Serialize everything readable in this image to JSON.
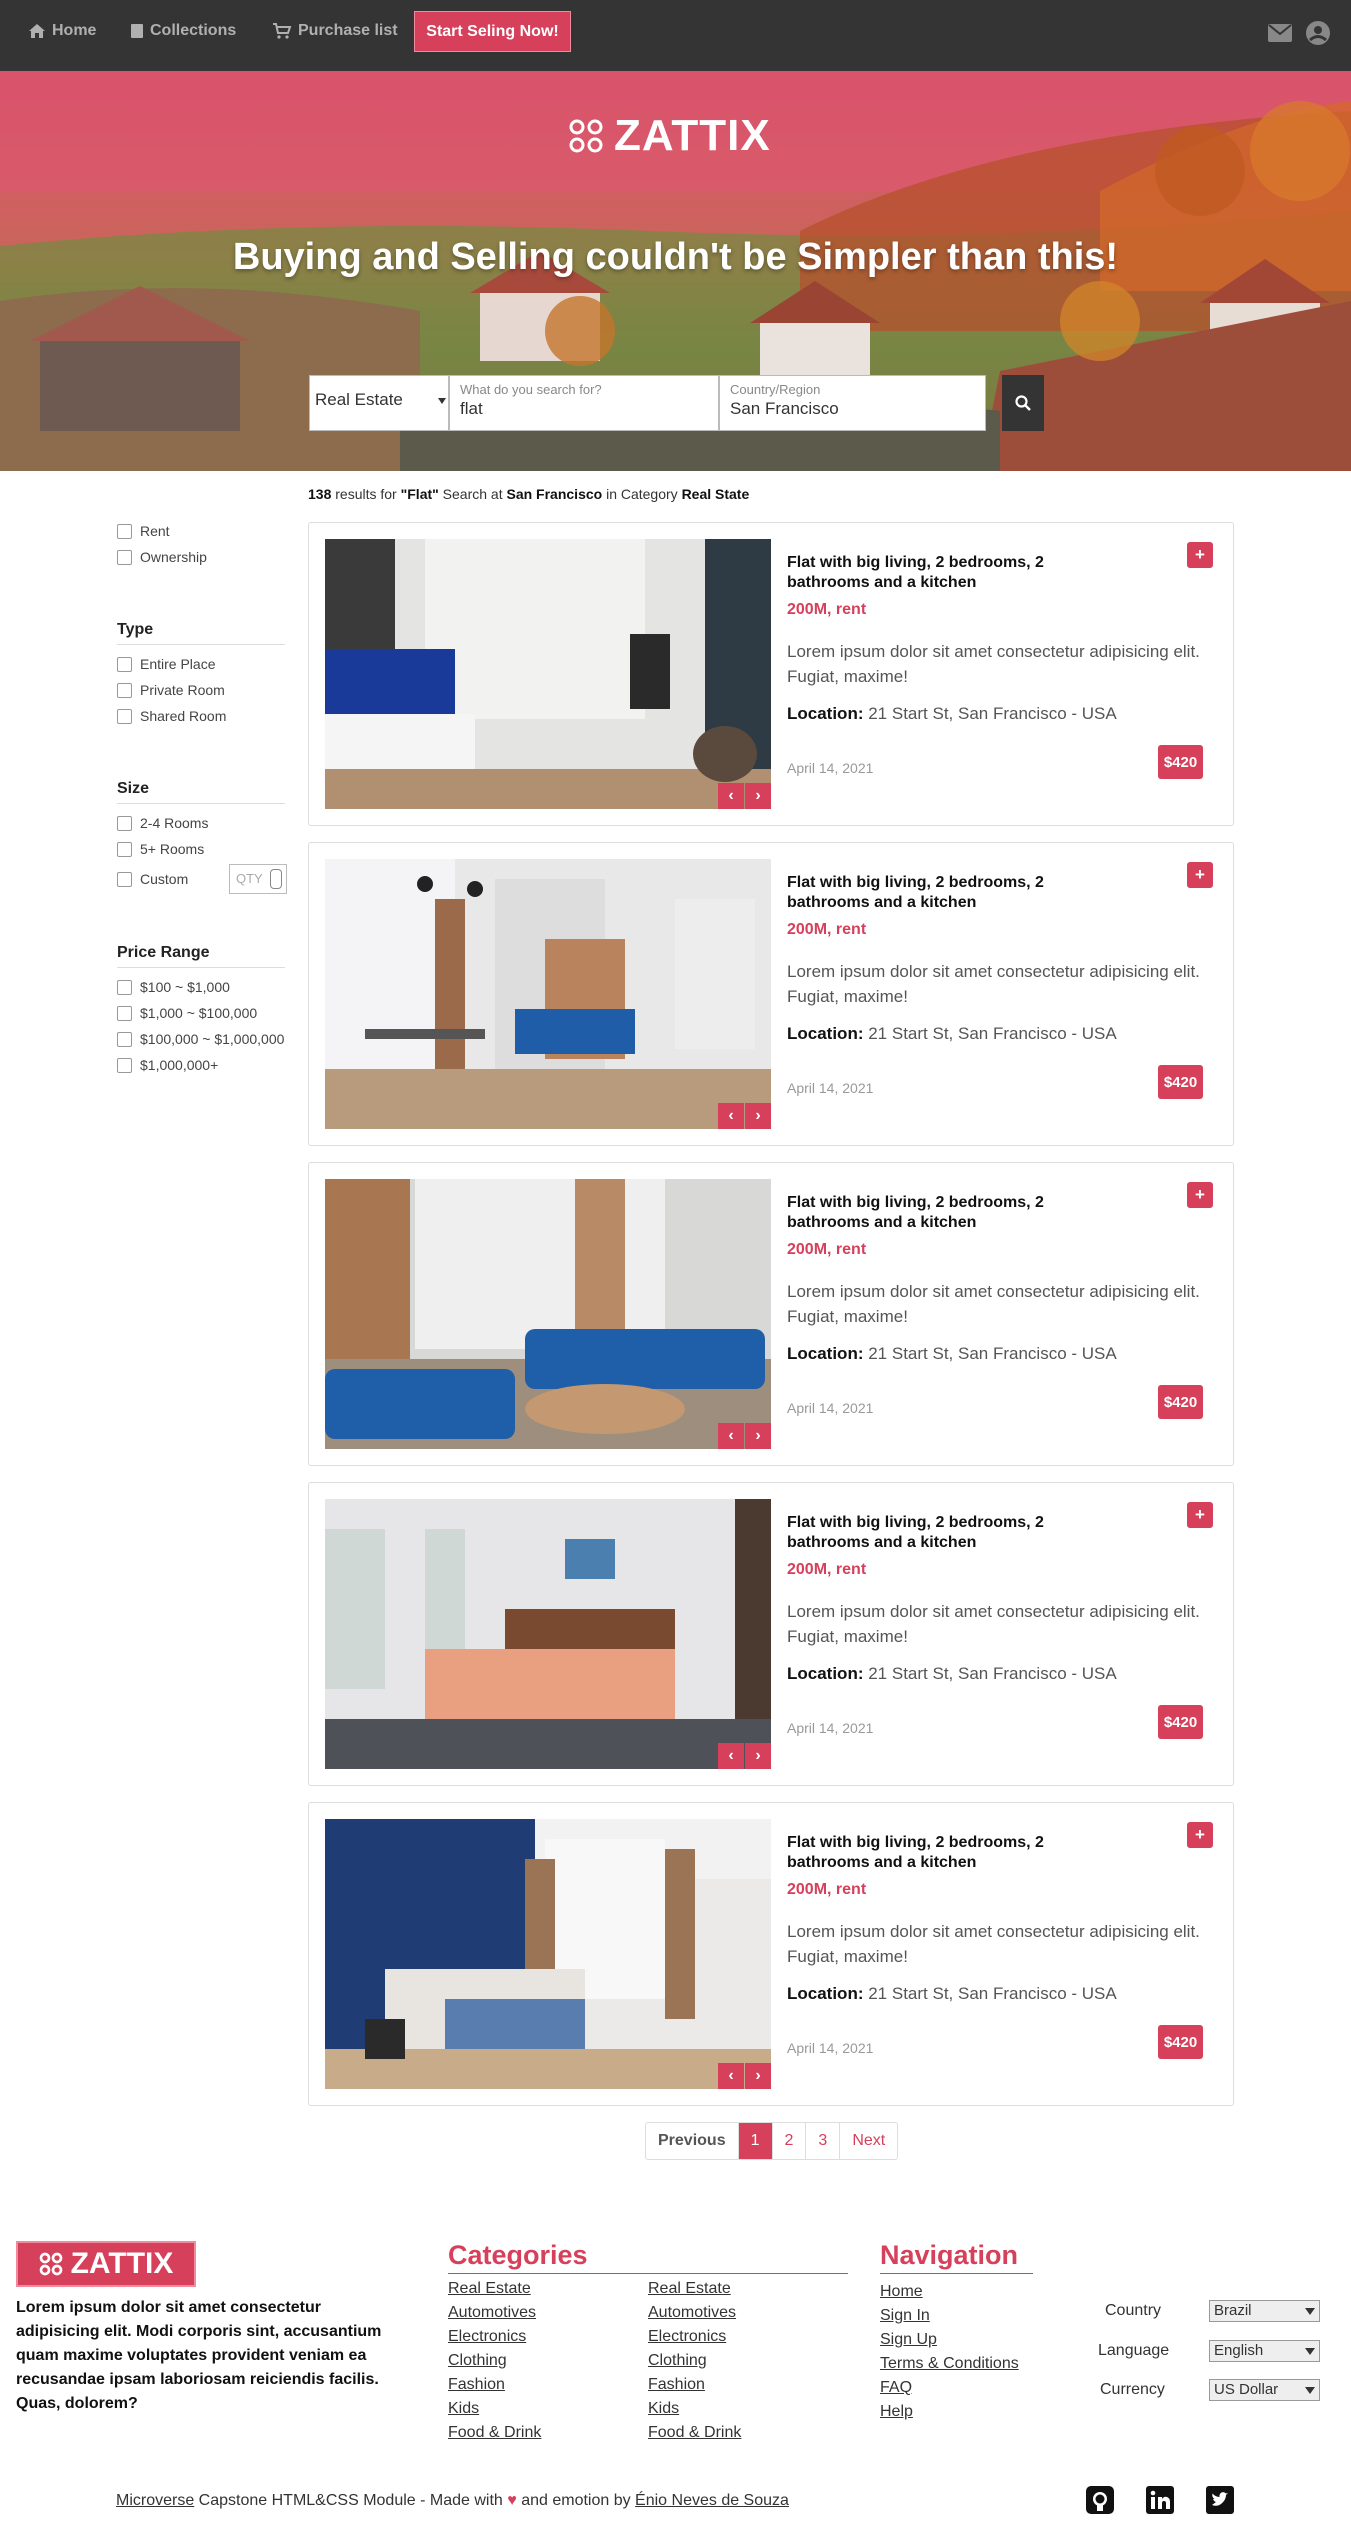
{
  "nav": {
    "home": "Home",
    "collections": "Collections",
    "purchase": "Purchase list",
    "sell": "Start Seling Now!"
  },
  "hero": {
    "brand": "ZATTIX",
    "title": "Buying and Selling couldn't be Simpler than this!",
    "category": "Real Estate",
    "search_label": "What do you search for?",
    "search_value": "flat",
    "region_label": "Country/Region",
    "region_value": "San Francisco"
  },
  "results": {
    "count": "138",
    "t1": " results for ",
    "query": "\"Flat\"",
    "t2": " Search at ",
    "place": "San Francisco",
    "t3": " in Category ",
    "category": "Real State"
  },
  "filters": {
    "purpose": [
      "Rent",
      "Ownership"
    ],
    "type_title": "Type",
    "type": [
      "Entire Place",
      "Private Room",
      "Shared Room"
    ],
    "size_title": "Size",
    "size": [
      "2-4 Rooms",
      "5+ Rooms",
      "Custom"
    ],
    "qty_placeholder": "QTY",
    "price_title": "Price Range",
    "price": [
      "$100 ~ $1,000",
      "$1,000 ~ $100,000",
      "$100,000 ~ $1,000,000",
      "$1,000,000+"
    ]
  },
  "listings": [
    {
      "title": "Flat with big living, 2 bedrooms, 2 bathrooms and a kitchen",
      "price": "200M, rent",
      "desc": "Lorem ipsum dolor sit amet consectetur adipisicing elit. Fugiat, maxime!",
      "loc_label": "Location:",
      "loc": " 21 Start St, San Francisco - USA",
      "date": "April 14, 2021",
      "badge": "$420",
      "plus": "+"
    },
    {
      "title": "Flat with big living, 2 bedrooms, 2 bathrooms and a kitchen",
      "price": "200M, rent",
      "desc": "Lorem ipsum dolor sit amet consectetur adipisicing elit. Fugiat, maxime!",
      "loc_label": "Location:",
      "loc": " 21 Start St, San Francisco - USA",
      "date": "April 14, 2021",
      "badge": "$420",
      "plus": "+"
    },
    {
      "title": "Flat with big living, 2 bedrooms, 2 bathrooms and a kitchen",
      "price": "200M, rent",
      "desc": "Lorem ipsum dolor sit amet consectetur adipisicing elit. Fugiat, maxime!",
      "loc_label": "Location:",
      "loc": " 21 Start St, San Francisco - USA",
      "date": "April 14, 2021",
      "badge": "$420",
      "plus": "+"
    },
    {
      "title": "Flat with big living, 2 bedrooms, 2 bathrooms and a kitchen",
      "price": "200M, rent",
      "desc": "Lorem ipsum dolor sit amet consectetur adipisicing elit. Fugiat, maxime!",
      "loc_label": "Location:",
      "loc": " 21 Start St, San Francisco - USA",
      "date": "April 14, 2021",
      "badge": "$420",
      "plus": "+"
    },
    {
      "title": "Flat with big living, 2 bedrooms, 2 bathrooms and a kitchen",
      "price": "200M, rent",
      "desc": "Lorem ipsum dolor sit amet consectetur adipisicing elit. Fugiat, maxime!",
      "loc_label": "Location:",
      "loc": " 21 Start St, San Francisco - USA",
      "date": "April 14, 2021",
      "badge": "$420",
      "plus": "+"
    }
  ],
  "pagination": {
    "prev": "Previous",
    "pages": [
      "1",
      "2",
      "3"
    ],
    "next": "Next"
  },
  "footer": {
    "brand": "ZATTIX",
    "about": "Lorem ipsum dolor sit amet consectetur adipisicing elit. Modi corporis sint, accusantium quam maxime voluptates provident veniam ea recusandae ipsam laboriosam reiciendis facilis. Quas, dolorem?",
    "categories_title": "Categories",
    "categories_col1": [
      "Real Estate",
      "Automotives",
      "Electronics",
      "Clothing",
      "Fashion",
      "Kids",
      "Food & Drink"
    ],
    "categories_col2": [
      "Real Estate",
      "Automotives",
      "Electronics",
      "Clothing",
      "Fashion",
      "Kids",
      "Food & Drink"
    ],
    "nav_title": "Navigation",
    "nav_links": [
      "Home",
      "Sign In",
      "Sign Up",
      "Terms & Conditions",
      "FAQ",
      "Help"
    ],
    "country_label": "Country",
    "country_value": "Brazil",
    "language_label": "Language",
    "language_value": "English",
    "currency_label": "Currency",
    "currency_value": "US Dollar",
    "credit_link1": "Microverse",
    "credit_mid": " Capstone HTML&CSS Module - Made with ",
    "credit_heart": "♥",
    "credit_mid2": " and emotion by ",
    "credit_link2": "Énio Neves de Souza"
  },
  "colors": {
    "accent": "#d6405a",
    "navbar": "#343434"
  }
}
